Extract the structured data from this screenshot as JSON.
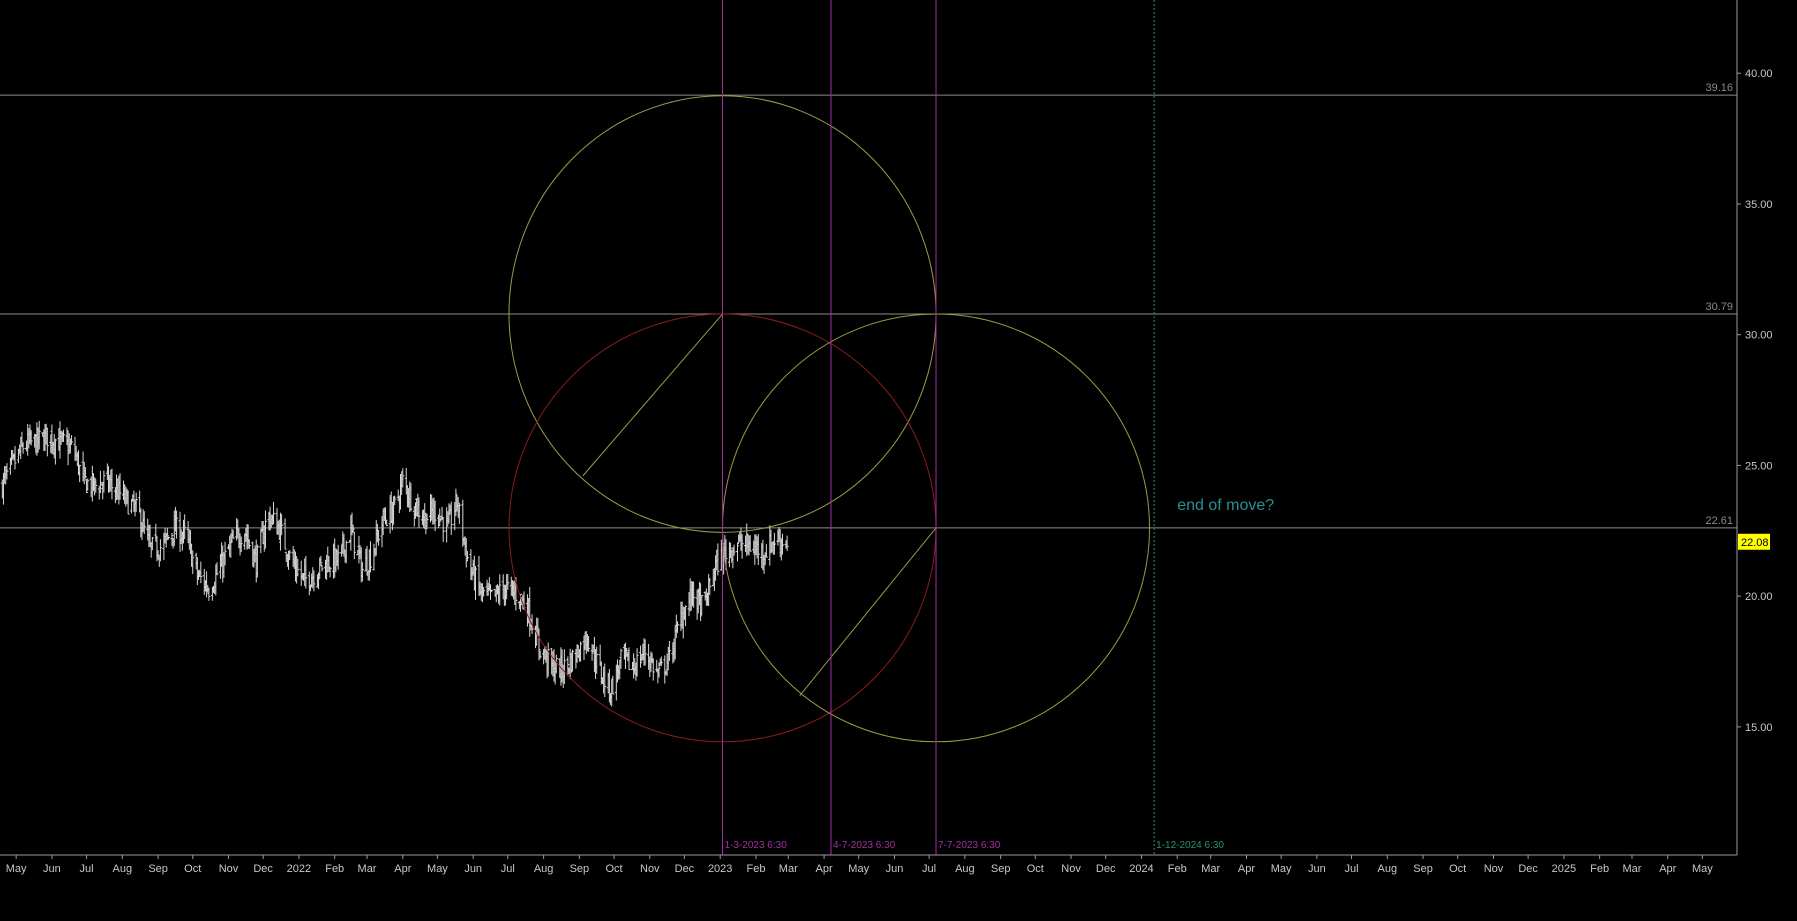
{
  "chart_data": {
    "type": "bar",
    "subtype": "ohlc-price-chart-with-drawings",
    "x_range": [
      "2021-04-17",
      "2025-05-31"
    ],
    "y_range": [
      10.1,
      42.8
    ],
    "y_ticks": [
      "40.00",
      "35.00",
      "30.00",
      "25.00",
      "20.00",
      "15.00"
    ],
    "x_ticks": [
      {
        "label": "May",
        "date": "2021-05-01"
      },
      {
        "label": "Jun",
        "date": "2021-06-01"
      },
      {
        "label": "Jul",
        "date": "2021-07-01"
      },
      {
        "label": "Aug",
        "date": "2021-08-01"
      },
      {
        "label": "Sep",
        "date": "2021-09-01"
      },
      {
        "label": "Oct",
        "date": "2021-10-01"
      },
      {
        "label": "Nov",
        "date": "2021-11-01"
      },
      {
        "label": "Dec",
        "date": "2021-12-01"
      },
      {
        "label": "2022",
        "date": "2022-01-01"
      },
      {
        "label": "Feb",
        "date": "2022-02-01"
      },
      {
        "label": "Mar",
        "date": "2022-03-01"
      },
      {
        "label": "Apr",
        "date": "2022-04-01"
      },
      {
        "label": "May",
        "date": "2022-05-01"
      },
      {
        "label": "Jun",
        "date": "2022-06-01"
      },
      {
        "label": "Jul",
        "date": "2022-07-01"
      },
      {
        "label": "Aug",
        "date": "2022-08-01"
      },
      {
        "label": "Sep",
        "date": "2022-09-01"
      },
      {
        "label": "Oct",
        "date": "2022-10-01"
      },
      {
        "label": "Nov",
        "date": "2022-11-01"
      },
      {
        "label": "Dec",
        "date": "2022-12-01"
      },
      {
        "label": "2023",
        "date": "2023-01-01"
      },
      {
        "label": "Feb",
        "date": "2023-02-01"
      },
      {
        "label": "Mar",
        "date": "2023-03-01"
      },
      {
        "label": "Apr",
        "date": "2023-04-01"
      },
      {
        "label": "May",
        "date": "2023-05-01"
      },
      {
        "label": "Jun",
        "date": "2023-06-01"
      },
      {
        "label": "Jul",
        "date": "2023-07-01"
      },
      {
        "label": "Aug",
        "date": "2023-08-01"
      },
      {
        "label": "Sep",
        "date": "2023-09-01"
      },
      {
        "label": "Oct",
        "date": "2023-10-01"
      },
      {
        "label": "Nov",
        "date": "2023-11-01"
      },
      {
        "label": "Dec",
        "date": "2023-12-01"
      },
      {
        "label": "2024",
        "date": "2024-01-01"
      },
      {
        "label": "Feb",
        "date": "2024-02-01"
      },
      {
        "label": "Mar",
        "date": "2024-03-01"
      },
      {
        "label": "Apr",
        "date": "2024-04-01"
      },
      {
        "label": "May",
        "date": "2024-05-01"
      },
      {
        "label": "Jun",
        "date": "2024-06-01"
      },
      {
        "label": "Jul",
        "date": "2024-07-01"
      },
      {
        "label": "Aug",
        "date": "2024-08-01"
      },
      {
        "label": "Sep",
        "date": "2024-09-01"
      },
      {
        "label": "Oct",
        "date": "2024-10-01"
      },
      {
        "label": "Nov",
        "date": "2024-11-01"
      },
      {
        "label": "Dec",
        "date": "2024-12-01"
      },
      {
        "label": "2025",
        "date": "2025-01-01"
      },
      {
        "label": "Feb",
        "date": "2025-02-01"
      },
      {
        "label": "Mar",
        "date": "2025-03-01"
      },
      {
        "label": "Apr",
        "date": "2025-04-01"
      },
      {
        "label": "May",
        "date": "2025-05-01"
      }
    ],
    "price_path": [
      [
        "2021-04-18",
        24.2
      ],
      [
        "2021-04-28",
        25.0
      ],
      [
        "2021-05-08",
        25.8
      ],
      [
        "2021-05-18",
        25.9
      ],
      [
        "2021-05-28",
        26.1
      ],
      [
        "2021-06-08",
        25.9
      ],
      [
        "2021-06-20",
        25.6
      ],
      [
        "2021-06-28",
        24.4
      ],
      [
        "2021-07-08",
        24.2
      ],
      [
        "2021-07-18",
        24.4
      ],
      [
        "2021-07-28",
        24.0
      ],
      [
        "2021-08-08",
        23.5
      ],
      [
        "2021-08-15",
        23.2
      ],
      [
        "2021-08-25",
        21.8
      ],
      [
        "2021-09-05",
        21.9
      ],
      [
        "2021-09-15",
        22.6
      ],
      [
        "2021-09-25",
        22.3
      ],
      [
        "2021-10-05",
        20.8
      ],
      [
        "2021-10-15",
        20.3
      ],
      [
        "2021-10-25",
        21.1
      ],
      [
        "2021-11-05",
        22.1
      ],
      [
        "2021-11-15",
        22.5
      ],
      [
        "2021-11-25",
        21.3
      ],
      [
        "2021-12-05",
        23.1
      ],
      [
        "2021-12-15",
        22.6
      ],
      [
        "2021-12-25",
        21.4
      ],
      [
        "2022-01-05",
        20.6
      ],
      [
        "2022-01-15",
        20.9
      ],
      [
        "2022-01-25",
        21.3
      ],
      [
        "2022-02-05",
        21.4
      ],
      [
        "2022-02-15",
        22.5
      ],
      [
        "2022-02-25",
        21.0
      ],
      [
        "2022-03-05",
        21.6
      ],
      [
        "2022-03-15",
        22.9
      ],
      [
        "2022-03-25",
        23.4
      ],
      [
        "2022-04-01",
        24.4
      ],
      [
        "2022-04-10",
        23.6
      ],
      [
        "2022-04-20",
        23.0
      ],
      [
        "2022-04-30",
        23.3
      ],
      [
        "2022-05-10",
        22.6
      ],
      [
        "2022-05-18",
        23.6
      ],
      [
        "2022-05-28",
        21.2
      ],
      [
        "2022-06-08",
        20.1
      ],
      [
        "2022-06-18",
        19.9
      ],
      [
        "2022-06-28",
        20.3
      ],
      [
        "2022-07-08",
        20.1
      ],
      [
        "2022-07-18",
        19.6
      ],
      [
        "2022-07-28",
        18.1
      ],
      [
        "2022-08-08",
        17.3
      ],
      [
        "2022-08-18",
        17.2
      ],
      [
        "2022-08-28",
        17.7
      ],
      [
        "2022-09-08",
        18.5
      ],
      [
        "2022-09-18",
        17.2
      ],
      [
        "2022-09-28",
        16.4
      ],
      [
        "2022-10-08",
        17.6
      ],
      [
        "2022-10-18",
        17.3
      ],
      [
        "2022-10-28",
        17.9
      ],
      [
        "2022-11-08",
        17.0
      ],
      [
        "2022-11-18",
        17.6
      ],
      [
        "2022-11-28",
        19.2
      ],
      [
        "2022-12-08",
        20.1
      ],
      [
        "2022-12-18",
        19.5
      ],
      [
        "2022-12-28",
        21.2
      ],
      [
        "2023-01-08",
        21.8
      ],
      [
        "2023-01-18",
        22.0
      ],
      [
        "2023-01-28",
        21.9
      ],
      [
        "2023-02-08",
        21.7
      ],
      [
        "2023-02-18",
        22.2
      ],
      [
        "2023-02-28",
        22.08
      ]
    ],
    "horizontal_levels": [
      {
        "value": 39.16,
        "label": "39.16"
      },
      {
        "value": 30.79,
        "label": "30.79"
      },
      {
        "value": 22.61,
        "label": "22.61"
      }
    ],
    "last_price": {
      "value": 22.08,
      "label": "22.08"
    },
    "vertical_markers": [
      {
        "date": "2023-01-03",
        "label": "1-3-2023 6:30",
        "color": "#a030a0",
        "dashed": false
      },
      {
        "date": "2023-04-07",
        "label": "4-7-2023 6:30",
        "color": "#a030a0",
        "dashed": false
      },
      {
        "date": "2023-07-07",
        "label": "7-7-2023 6:30",
        "color": "#a030a0",
        "dashed": false
      },
      {
        "date": "2024-01-12",
        "label": "1-12-2024 6:30",
        "color": "#2a8f72",
        "dashed": true
      }
    ],
    "circles": [
      {
        "center_date": "2023-01-03",
        "center_value": 30.79,
        "radius_days": 185,
        "radius_value": 8.35,
        "color": "#9c9a48"
      },
      {
        "center_date": "2023-01-03",
        "center_value": 22.61,
        "radius_days": 185,
        "radius_value": 8.18,
        "color": "#8a1c1c"
      },
      {
        "center_date": "2023-07-07",
        "center_value": 22.61,
        "radius_days": 185,
        "radius_value": 8.18,
        "color": "#9c9a48"
      }
    ],
    "radius_lines": [
      {
        "from_date": "2023-01-03",
        "from_value": 30.79,
        "to_date": "2022-09-04",
        "to_value": 24.6,
        "color": "#9c9a48"
      },
      {
        "from_date": "2023-07-07",
        "from_value": 22.61,
        "to_date": "2023-03-11",
        "to_value": 16.2,
        "color": "#9c9a48"
      }
    ],
    "annotation": {
      "text": "end of move?",
      "date": "2024-02-01",
      "value": 23.3,
      "color": "#2a9090"
    },
    "colors": {
      "background": "#000000",
      "price_bars": "#d8d8d8",
      "levels": "#8c8c84",
      "axis": "#9a9a9a",
      "axis_text": "#c8c8c8",
      "last_price_bg": "#ffff00"
    }
  }
}
